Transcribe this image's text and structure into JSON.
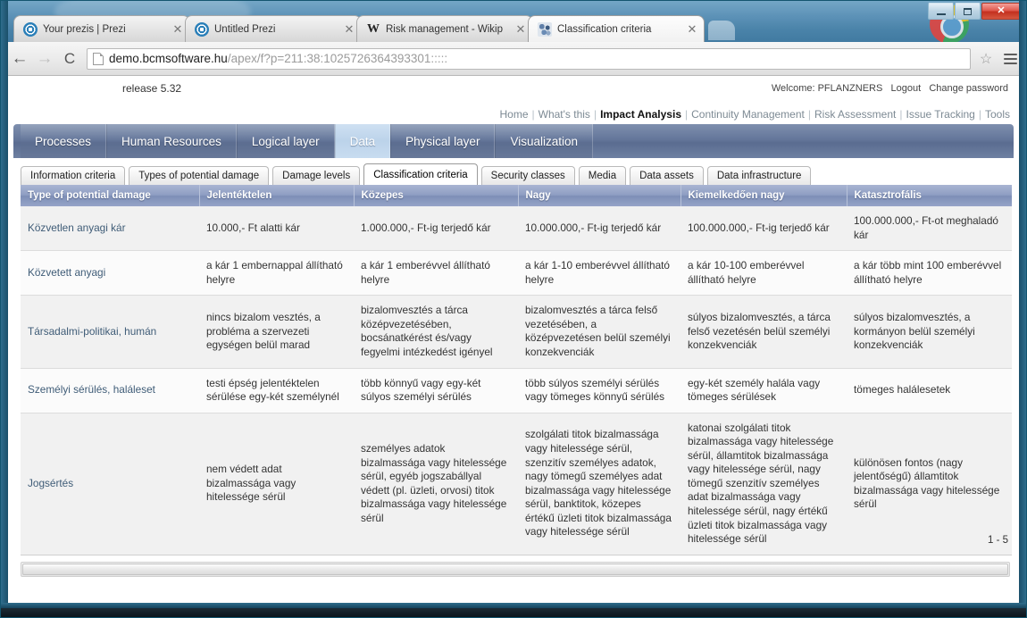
{
  "browser": {
    "tabs": [
      {
        "title": "Your prezis | Prezi",
        "favicon": "prezi-icon",
        "active": false
      },
      {
        "title": "Untitled Prezi",
        "favicon": "prezi-icon",
        "active": false
      },
      {
        "title": "Risk management - Wikip",
        "favicon": "wikipedia-icon",
        "active": false
      },
      {
        "title": "Classification criteria",
        "favicon": "app-icon",
        "active": true
      }
    ],
    "window_controls": {
      "minimize": "–",
      "maximize": "□",
      "close": "✕"
    },
    "nav": {
      "back": "←",
      "forward": "→",
      "reload": "⟳"
    },
    "url_domain": "demo.bcmsoftware.hu",
    "url_path": "/apex/f?p=211:38:1025726364393301:::::",
    "bookmark_star": "☆",
    "menu": "menu-icon"
  },
  "app": {
    "release": "release 5.32",
    "welcome_label": "Welcome: PFLANZNERS",
    "logout_label": "Logout",
    "change_password_label": "Change password",
    "topnav": [
      {
        "label": "Home",
        "current": false
      },
      {
        "label": "What's this",
        "current": false
      },
      {
        "label": "Impact Analysis",
        "current": true
      },
      {
        "label": "Continuity Management",
        "current": false
      },
      {
        "label": "Risk Assessment",
        "current": false
      },
      {
        "label": "Issue Tracking",
        "current": false
      },
      {
        "label": "Tools",
        "current": false
      }
    ],
    "main_tabs": [
      {
        "label": "Processes",
        "active": false
      },
      {
        "label": "Human Resources",
        "active": false
      },
      {
        "label": "Logical layer",
        "active": false
      },
      {
        "label": "Data",
        "active": true
      },
      {
        "label": "Physical layer",
        "active": false
      },
      {
        "label": "Visualization",
        "active": false
      }
    ],
    "sub_tabs": [
      {
        "label": "Information criteria",
        "active": false
      },
      {
        "label": "Types of potential damage",
        "active": false
      },
      {
        "label": "Damage levels",
        "active": false
      },
      {
        "label": "Classification criteria",
        "active": true
      },
      {
        "label": "Security classes",
        "active": false
      },
      {
        "label": "Media",
        "active": false
      },
      {
        "label": "Data assets",
        "active": false
      },
      {
        "label": "Data infrastructure",
        "active": false
      }
    ],
    "pager": "1 - 5"
  },
  "table": {
    "columns": [
      "Type of potential damage",
      "Jelentéktelen",
      "Közepes",
      "Nagy",
      "Kiemelkedően nagy",
      "Katasztrofális"
    ],
    "rows": [
      [
        "Közvetlen anyagi kár",
        "10.000,- Ft alatti kár",
        "1.000.000,- Ft-ig terjedő kár",
        "10.000.000,- Ft-ig terjedő kár",
        "100.000.000,- Ft-ig terjedő kár",
        "100.000.000,- Ft-ot meghaladó kár"
      ],
      [
        "Közvetett anyagi",
        "a kár 1 embernappal állítható helyre",
        "a kár 1 emberévvel állítható helyre",
        "a kár 1-10 emberévvel állítható helyre",
        "a kár 10-100 emberévvel állítható helyre",
        "a kár több mint 100 emberévvel állítható helyre"
      ],
      [
        "Társadalmi-politikai, humán",
        "nincs bizalom vesztés, a probléma a szervezeti egységen belül marad",
        "bizalomvesztés a tárca középvezetésében, bocsánatkérést és/vagy fegyelmi intézkedést igényel",
        "bizalomvesztés a tárca felső vezetésében, a középvezetésen belül személyi konzekvenciák",
        "súlyos bizalomvesztés, a tárca felső vezetésén belül személyi konzekvenciák",
        "súlyos bizalomvesztés, a kormányon belül személyi konzekvenciák"
      ],
      [
        "Személyi sérülés, haláleset",
        "testi épség jelentéktelen sérülése egy-két személynél",
        "több könnyű vagy egy-két súlyos személyi sérülés",
        "több súlyos személyi sérülés vagy tömeges könnyű sérülés",
        "egy-két személy halála vagy tömeges sérülések",
        "tömeges halálesetek"
      ],
      [
        "Jogsértés",
        "nem védett adat bizalmassága vagy hitelessége sérül",
        "személyes adatok bizalmassága vagy hitelessége sérül, egyéb jogszabállyal védett (pl. üzleti, orvosi) titok bizalmassága vagy hitelessége sérül",
        "szolgálati titok bizalmassága vagy hitelessége sérül, szenzitív személyes adatok, nagy tömegű személyes adat bizalmassága vagy hitelessége sérül, banktitok, közepes értékű üzleti titok bizalmassága vagy hitelessége sérül",
        "katonai szolgálati titok bizalmassága vagy hitelessége sérül, államtitok bizalmassága vagy hitelessége sérül, nagy tömegű szenzitív személyes adat bizalmassága vagy hitelessége sérül, nagy értékű üzleti titok bizalmassága vagy hitelessége sérül",
        "különösen fontos (nagy jelentőségű) államtitok bizalmassága vagy hitelessége sérül"
      ]
    ]
  },
  "colors": {
    "table_header": "#8e9dc2",
    "main_nav": "#64769a",
    "active_main_tab": "#c4d8ee",
    "link_blue": "#3f5c77",
    "window_chrome": "#4d86ac"
  }
}
